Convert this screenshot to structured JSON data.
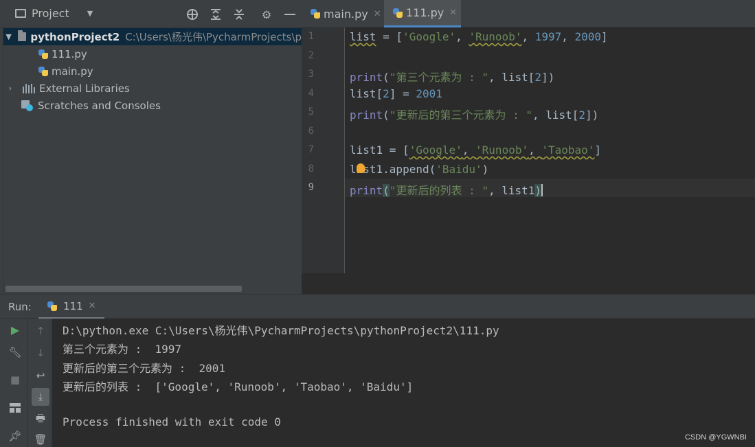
{
  "project_panel": {
    "title": "Project",
    "tree": [
      {
        "label": "pythonProject2",
        "path": "C:\\Users\\杨光伟\\PycharmProjects\\p"
      },
      {
        "label": "111.py"
      },
      {
        "label": "main.py"
      },
      {
        "label": "External Libraries"
      },
      {
        "label": "Scratches and Consoles"
      }
    ]
  },
  "editor": {
    "tabs": [
      {
        "label": "main.py",
        "active": false
      },
      {
        "label": "111.py",
        "active": true
      }
    ],
    "line_numbers": [
      "1",
      "2",
      "3",
      "4",
      "5",
      "6",
      "7",
      "8",
      "9"
    ],
    "current_line": "9",
    "code": {
      "l1": {
        "a": "list",
        "b": " = [",
        "c": "'Google'",
        "d": ", ",
        "e": "'Runoob'",
        "f": ", ",
        "g": "1997",
        "h": ", ",
        "i": "2000",
        "j": "]"
      },
      "l3": {
        "a": "print",
        "b": "(",
        "c": "\"第三个元素为 : \"",
        "d": ", list[",
        "e": "2",
        "f": "])"
      },
      "l4": {
        "a": "list[",
        "b": "2",
        "c": "] = ",
        "d": "2001"
      },
      "l5": {
        "a": "print",
        "b": "(",
        "c": "\"更新后的第三个元素为 : \"",
        "d": ", list[",
        "e": "2",
        "f": "])"
      },
      "l7": {
        "a": "list1 = [",
        "b": "'Google'",
        "c": ", ",
        "d": "'Runoob'",
        "e": ", ",
        "f": "'Taobao'",
        "g": "]"
      },
      "l8": {
        "a": "list1.append(",
        "b": "'Baidu'",
        "c": ")"
      },
      "l9": {
        "a": "print",
        "b": "(",
        "c": "\"更新后的列表 : \"",
        "d": ", list1",
        "e": ")"
      }
    }
  },
  "run_panel": {
    "label": "Run:",
    "tab_label": "111",
    "output": [
      "D:\\python.exe C:\\Users\\杨光伟\\PycharmProjects\\pythonProject2\\111.py",
      "第三个元素为 :  1997",
      "更新后的第三个元素为 :  2001",
      "更新后的列表 :  ['Google', 'Runoob', 'Taobao', 'Baidu']",
      "",
      "Process finished with exit code 0"
    ]
  },
  "watermark": "CSDN @YGWNBI",
  "colors": {
    "keyword": "#8888c6",
    "string": "#6a8759",
    "number": "#6897bb",
    "text": "#a9b7c6",
    "accent": "#4a88c7",
    "run_green": "#59a869"
  },
  "icons": [
    "project-square-icon",
    "dropdown-caret-icon",
    "locate-target-icon",
    "expand-all-icon",
    "collapse-all-icon",
    "gear-icon",
    "minimize-icon",
    "folder-icon",
    "python-file-icon",
    "library-icon",
    "scratches-icon",
    "run-play-icon",
    "wrench-icon",
    "stop-icon",
    "layout-icon",
    "pin-icon",
    "arrow-up-icon",
    "arrow-down-icon",
    "soft-wrap-icon",
    "scroll-to-end-icon",
    "print-icon",
    "trash-icon",
    "lightbulb-icon"
  ]
}
